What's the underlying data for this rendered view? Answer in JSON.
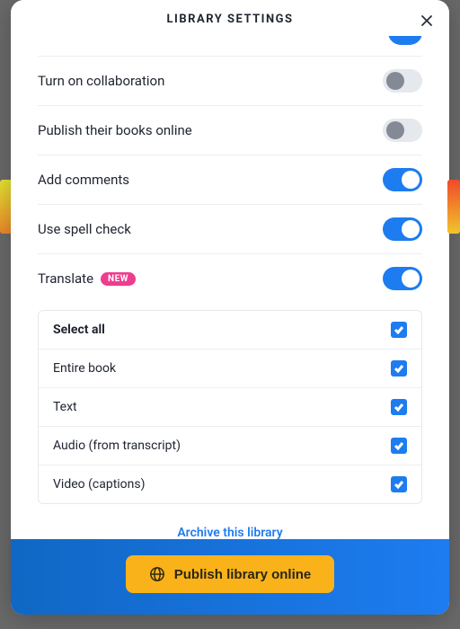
{
  "header": {
    "title": "LIBRARY SETTINGS"
  },
  "settings": {
    "collaboration": {
      "label": "Turn on collaboration",
      "state": "off"
    },
    "publish_books": {
      "label": "Publish their books online",
      "state": "off"
    },
    "comments": {
      "label": "Add comments",
      "state": "on"
    },
    "spellcheck": {
      "label": "Use spell check",
      "state": "on"
    },
    "translate": {
      "label": "Translate",
      "badge": "NEW",
      "state": "on"
    }
  },
  "translate_options": {
    "select_all": {
      "label": "Select all",
      "checked": true
    },
    "entire_book": {
      "label": "Entire book",
      "checked": true
    },
    "text": {
      "label": "Text",
      "checked": true
    },
    "audio": {
      "label": "Audio (from transcript)",
      "checked": true
    },
    "video": {
      "label": "Video (captions)",
      "checked": true
    }
  },
  "links": {
    "archive": "Archive this library"
  },
  "footer": {
    "publish_label": "Publish library online"
  }
}
